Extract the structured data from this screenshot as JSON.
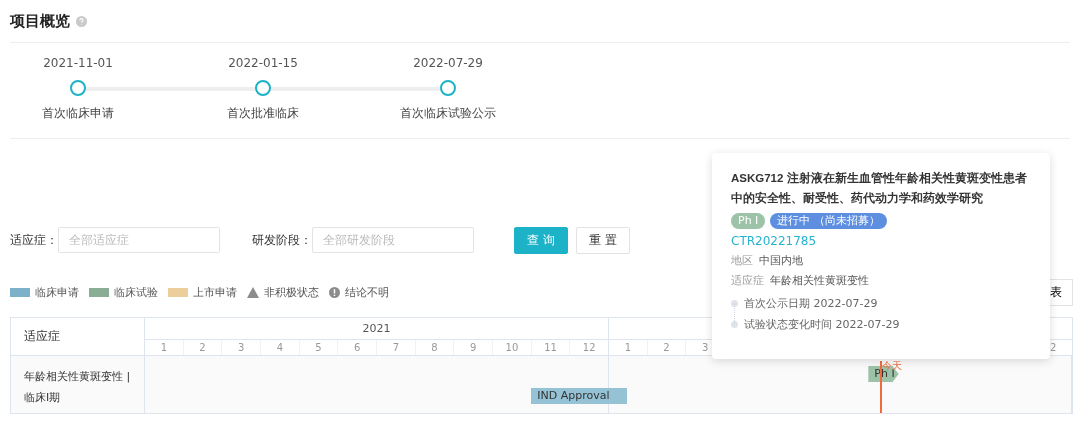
{
  "header": {
    "title": "项目概览"
  },
  "milestones": [
    {
      "date": "2021-11-01",
      "label": "首次临床申请"
    },
    {
      "date": "2022-01-15",
      "label": "首次批准临床"
    },
    {
      "date": "2022-07-29",
      "label": "首次临床试验公示"
    }
  ],
  "filters": [
    {
      "label": "适应症：",
      "placeholder": "全部适应症"
    },
    {
      "label": "研发阶段：",
      "placeholder": "全部研发阶段"
    }
  ],
  "buttons": [
    {
      "label": "查 询",
      "kind": "primary"
    },
    {
      "label": "重 置",
      "kind": "default"
    }
  ],
  "legend": [
    {
      "label": "临床申请",
      "kind": "swatch",
      "color": "#7db0c9"
    },
    {
      "label": "临床试验",
      "kind": "swatch",
      "color": "#8aae95"
    },
    {
      "label": "上市申请",
      "kind": "swatch",
      "color": "#eccd9c"
    },
    {
      "label": "非积极状态",
      "kind": "triangle"
    },
    {
      "label": "结论不明",
      "kind": "alert"
    }
  ],
  "view_button": {
    "label": "表"
  },
  "gantt": {
    "corner": "适应症",
    "years": [
      {
        "label": "2021",
        "months": [
          "1",
          "2",
          "3",
          "4",
          "5",
          "6",
          "7",
          "8",
          "9",
          "10",
          "11",
          "12"
        ]
      },
      {
        "months": [
          "1",
          "2",
          "3"
        ],
        "last_month": "2"
      }
    ],
    "rows": [
      {
        "label": "年龄相关性黄斑变性 |\n临床I期",
        "bars": [
          {
            "label": "IND Approval",
            "kind": "application"
          },
          {
            "label": "Ph I",
            "kind": "trial"
          }
        ]
      }
    ],
    "today": {
      "label": "今天"
    }
  },
  "tooltip": {
    "title": "ASKG712 注射液在新生血管性年龄相关性黄斑变性患者中的安全性、耐受性、药代动力学和药效学研究",
    "tags": [
      {
        "label": "Ph I",
        "kind": "phase"
      },
      {
        "label": "进行中 （尚未招募）",
        "kind": "status"
      }
    ],
    "link": "CTR20221785",
    "fields": [
      {
        "label": "地区",
        "value": "中国内地"
      },
      {
        "label": "适应症",
        "value": "年龄相关性黄斑变性"
      }
    ],
    "events": [
      {
        "label": "首次公示日期 2022-07-29"
      },
      {
        "label": "试验状态变化时间 2022-07-29"
      }
    ]
  }
}
